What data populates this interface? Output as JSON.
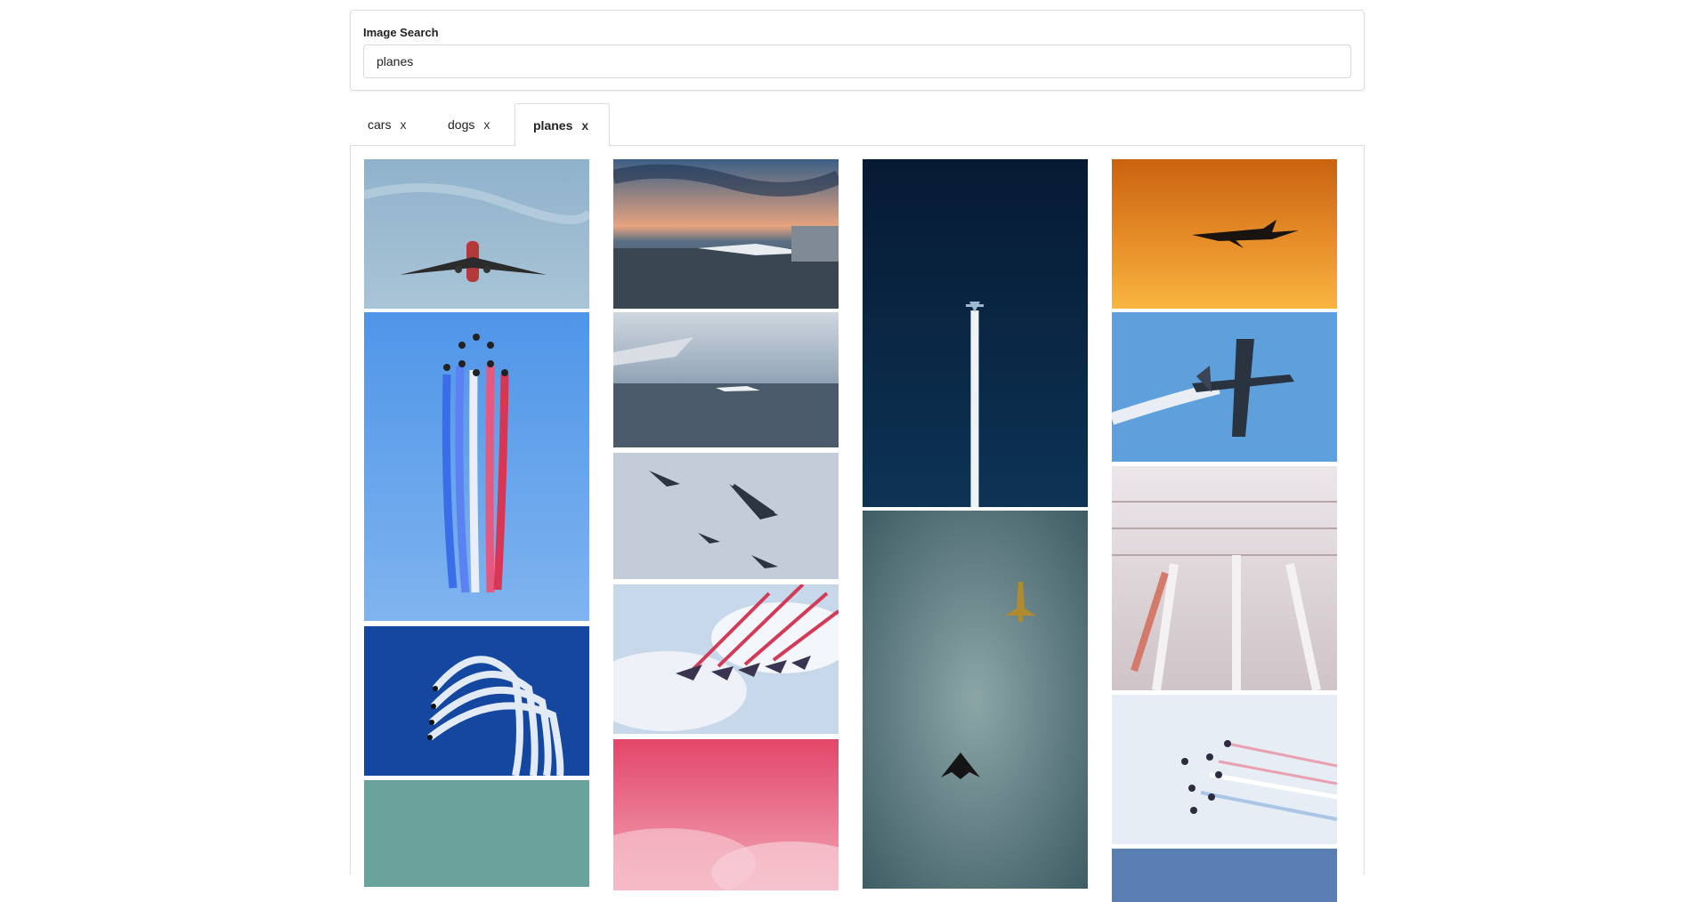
{
  "search": {
    "label": "Image Search",
    "value": "planes"
  },
  "tabs": [
    {
      "label": "cars",
      "close": "x",
      "active": false
    },
    {
      "label": "dogs",
      "close": "x",
      "active": false
    },
    {
      "label": "planes",
      "close": "x",
      "active": true
    }
  ],
  "results": {
    "images": [
      {
        "subject": "airliner-in-sky"
      },
      {
        "subject": "jet-formation-tricolor-smoke"
      },
      {
        "subject": "jets-white-smoke-loop"
      },
      {
        "subject": "teal-sky"
      },
      {
        "subject": "airport-gate-sunset"
      },
      {
        "subject": "window-view-wing"
      },
      {
        "subject": "vintage-biplanes"
      },
      {
        "subject": "formation-red-smoke-clouds"
      },
      {
        "subject": "pink-sky"
      },
      {
        "subject": "contrail-dark-blue"
      },
      {
        "subject": "stealth-bomber-and-jet"
      },
      {
        "subject": "jumbo-jet-sunset"
      },
      {
        "subject": "warbird-white-smoke"
      },
      {
        "subject": "airport-aerial"
      },
      {
        "subject": "jet-team-tricolor-trails"
      },
      {
        "subject": "blue-sky-strip"
      }
    ]
  }
}
